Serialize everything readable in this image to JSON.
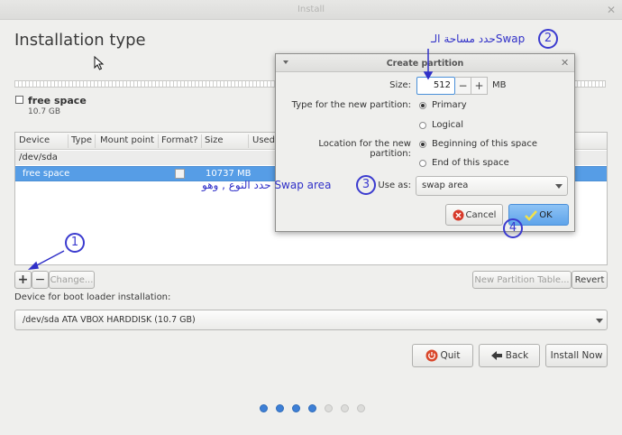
{
  "window": {
    "title": "Install",
    "close_glyph": "✕"
  },
  "page_title": "Installation type",
  "partition_legend": {
    "name": "free space",
    "size": "10.7 GB"
  },
  "table": {
    "columns": [
      "Device",
      "Type",
      "Mount point",
      "Format?",
      "Size",
      "Used"
    ],
    "device_row": "/dev/sda",
    "selected_row": {
      "device": "free space",
      "size": "10737 MB",
      "format_checked": false
    }
  },
  "toolbar": {
    "add": "+",
    "remove": "−",
    "change": "Change...",
    "new_table": "New Partition Table...",
    "revert": "Revert"
  },
  "boot": {
    "label": "Device for boot loader installation:",
    "selected": "/dev/sda  ATA VBOX HARDDISK (10.7 GB)"
  },
  "nav": {
    "quit": "Quit",
    "back": "Back",
    "install": "Install Now"
  },
  "progress": {
    "total": 7,
    "completed": 4,
    "active_color": "#3d7fd6",
    "inactive_color": "#dcdcda"
  },
  "dialog": {
    "title": "Create partition",
    "size_label": "Size:",
    "size_value": "512",
    "size_unit": "MB",
    "type_label": "Type for the new partition:",
    "type_options": [
      "Primary",
      "Logical"
    ],
    "type_selected": "Primary",
    "location_label": "Location for the new partition:",
    "location_options": [
      "Beginning of this space",
      "End of this space"
    ],
    "location_selected": "Beginning of this space",
    "useas_label": "Use as:",
    "useas_value": "swap area",
    "cancel": "Cancel",
    "ok": "OK"
  },
  "annotations": {
    "badge1": "1",
    "badge2": "2",
    "badge3": "3",
    "badge4": "4",
    "note2": "حدد مساحة الـSwap",
    "note3": "حدد النوع , وهو Swap area",
    "color": "#3030c8"
  }
}
